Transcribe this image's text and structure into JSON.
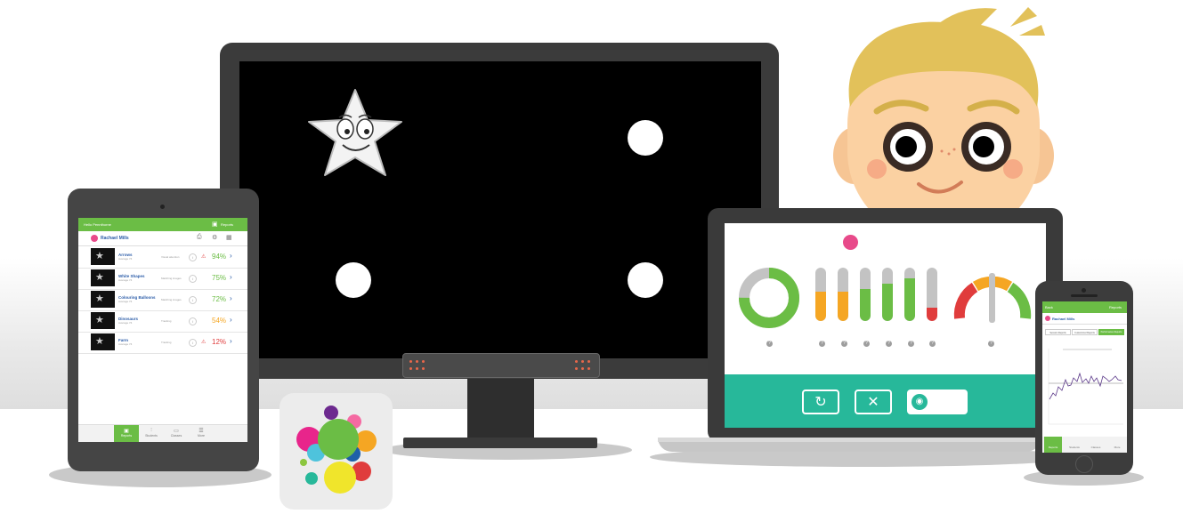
{
  "tablet": {
    "header_greeting": "Hello Pennthorne",
    "header_reports": "Reports",
    "user_name": "Rachael Mills",
    "rows": [
      {
        "name": "Arrows",
        "sub": "Average 74",
        "category": "Visual attention",
        "percent": "94%",
        "color": "#6bbd45",
        "warning": true
      },
      {
        "name": "White Shapes",
        "sub": "Average 74",
        "category": "Matching images",
        "percent": "75%",
        "color": "#6bbd45",
        "warning": false
      },
      {
        "name": "Colouring Balloons",
        "sub": "Average 74",
        "category": "Matching images",
        "percent": "72%",
        "color": "#6bbd45",
        "warning": false
      },
      {
        "name": "Dinosaurs",
        "sub": "Average 74",
        "category": "Tracking",
        "percent": "54%",
        "color": "#f5a623",
        "warning": false
      },
      {
        "name": "Farm",
        "sub": "Average 74",
        "category": "Tracking",
        "percent": "12%",
        "color": "#e03c3c",
        "warning": true
      }
    ],
    "nav": [
      "Reports",
      "Students",
      "Classes",
      "More"
    ]
  },
  "laptop": {
    "bars": [
      {
        "fill": 0.55,
        "color": "#f5a623"
      },
      {
        "fill": 0.55,
        "color": "#f5a623"
      },
      {
        "fill": 0.6,
        "color": "#6bbd45"
      },
      {
        "fill": 0.7,
        "color": "#6bbd45"
      },
      {
        "fill": 0.8,
        "color": "#6bbd45"
      },
      {
        "fill": 0.25,
        "color": "#e03c3c"
      }
    ],
    "donut_fill": 0.75,
    "buttons": [
      {
        "icon": "refresh-icon",
        "glyph": "↻"
      },
      {
        "icon": "close-icon",
        "glyph": "✕"
      }
    ]
  },
  "phone": {
    "back": "Back",
    "reports": "Reports",
    "user_name": "Rachael Mills",
    "tabs": [
      "Session Reports",
      "Customized Reports",
      "Performance Reports"
    ],
    "nav": [
      "Reports",
      "Students",
      "Classes",
      "More"
    ]
  },
  "colors": {
    "green": "#6bbd45",
    "teal": "#27b89a",
    "orange": "#f5a623",
    "red": "#e03c3c",
    "blue": "#2b5ca8"
  }
}
